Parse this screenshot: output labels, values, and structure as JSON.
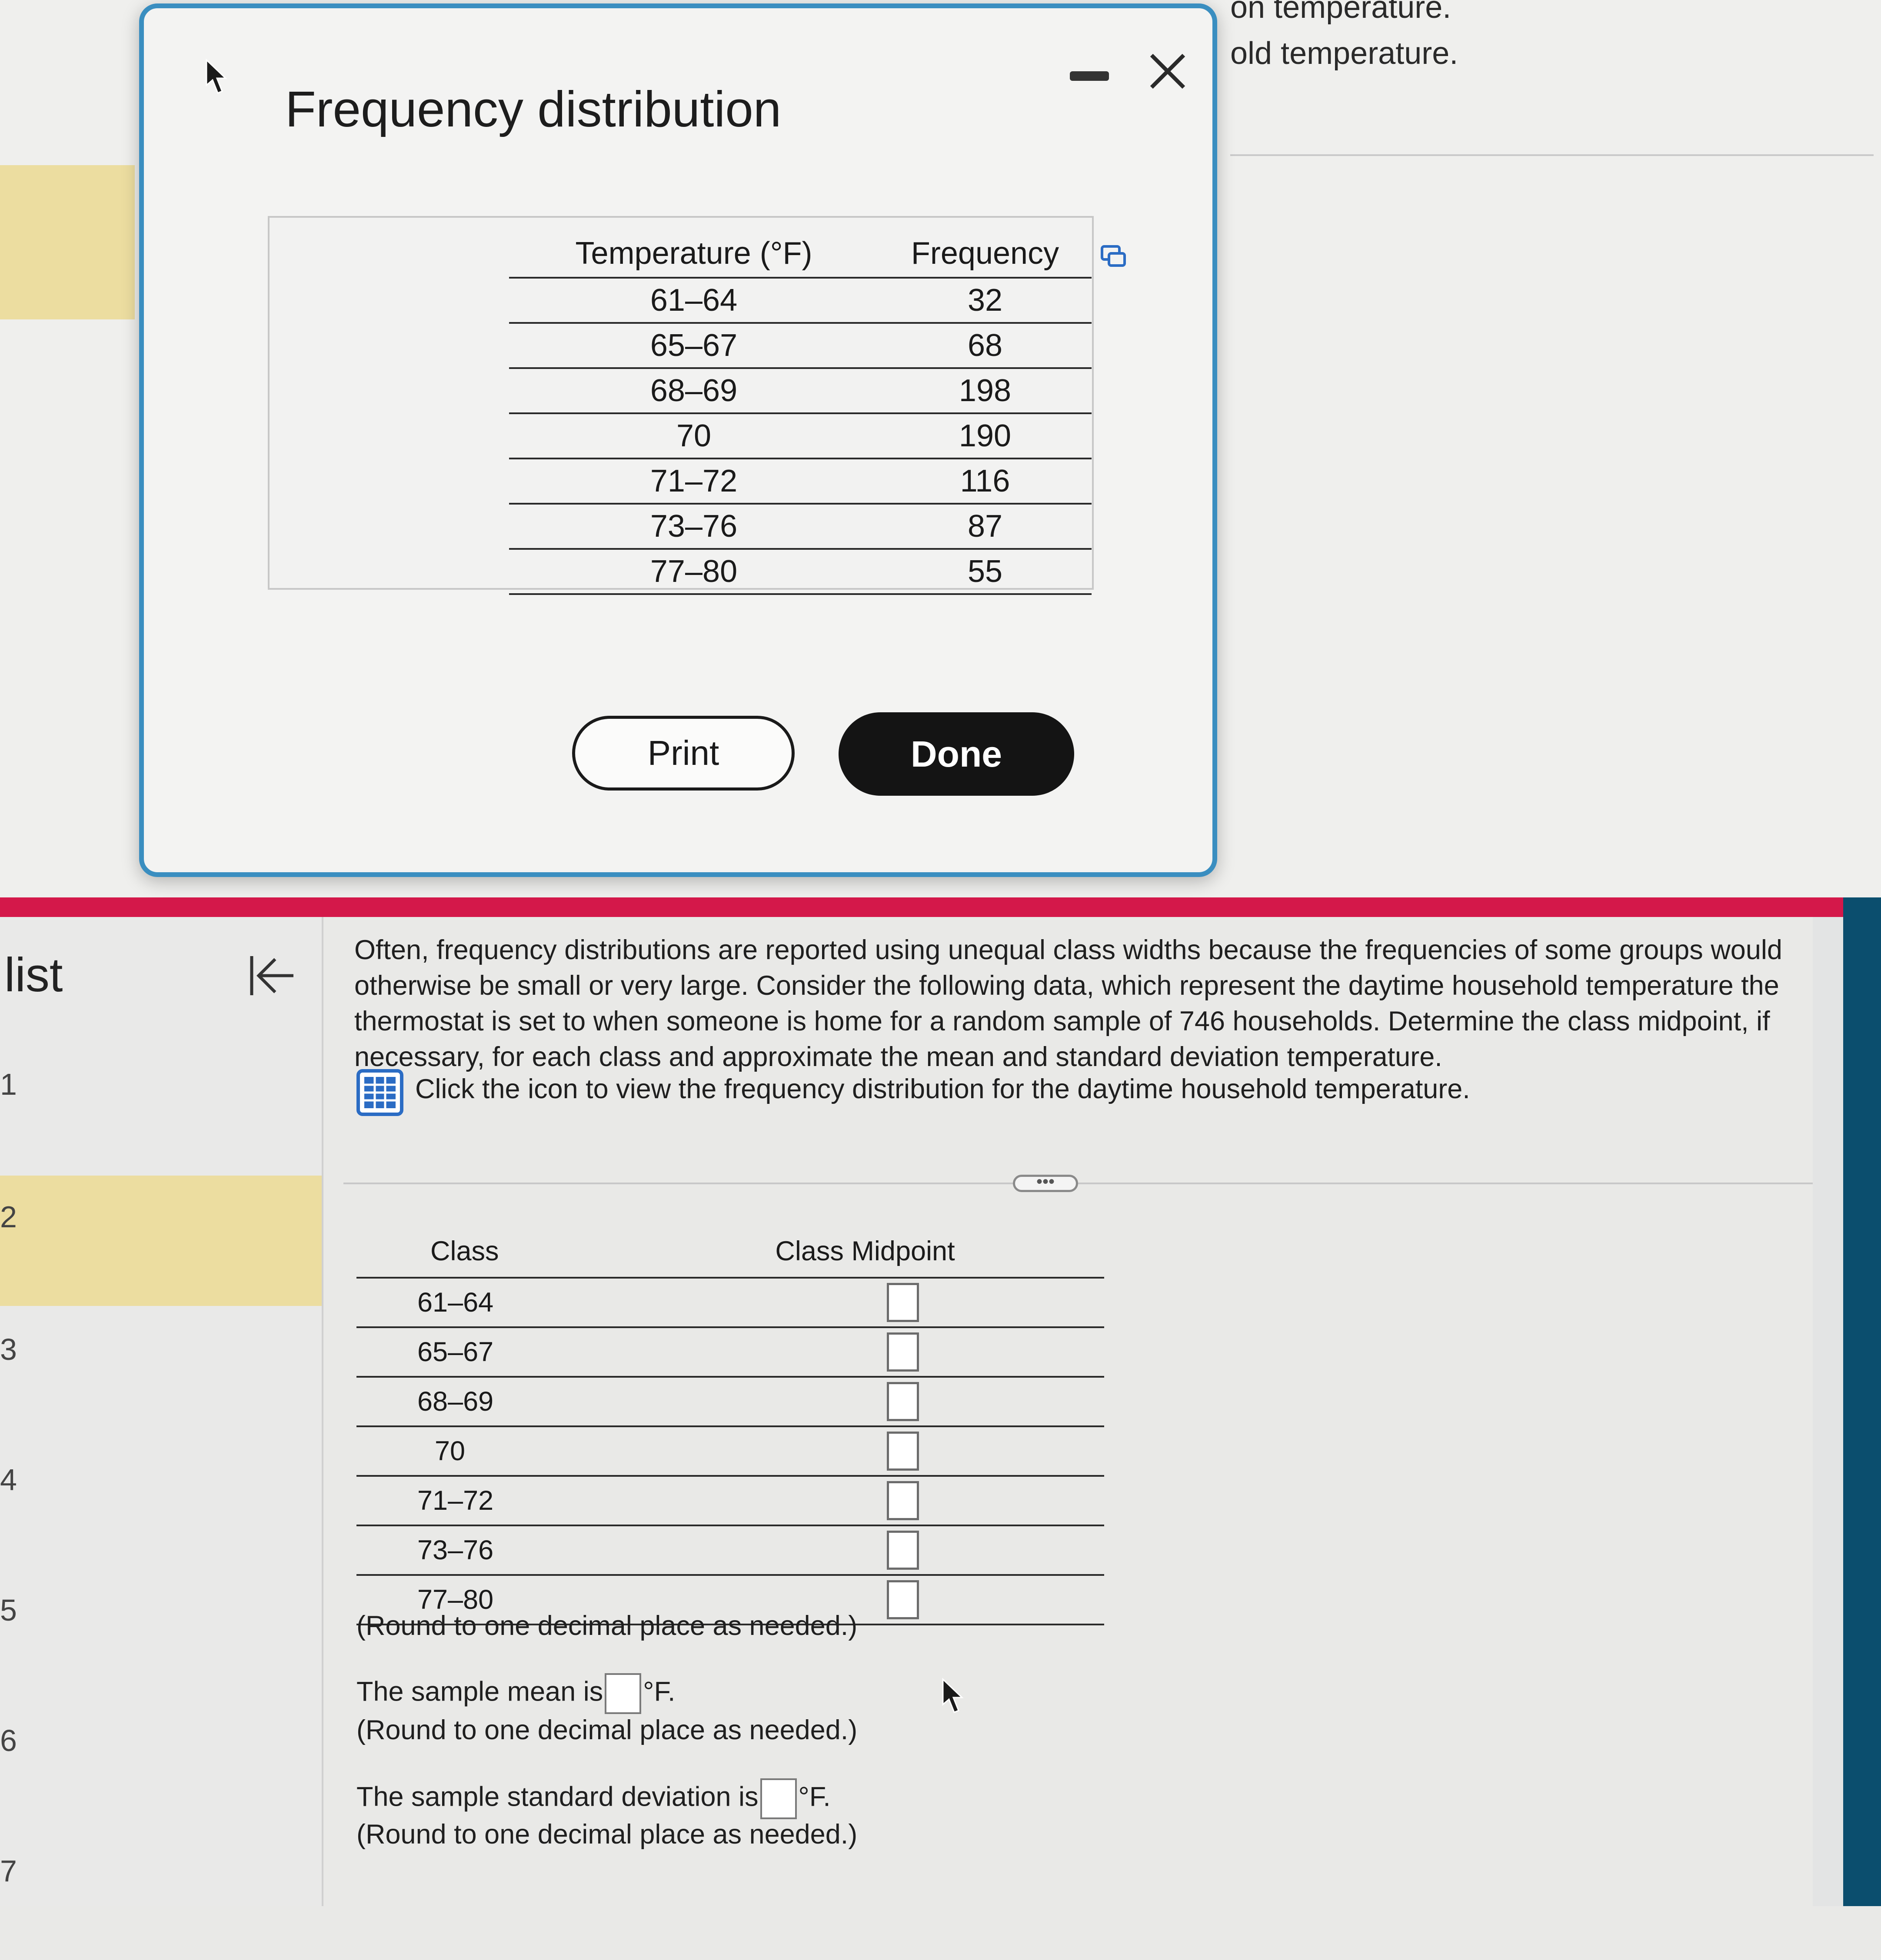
{
  "background": {
    "snippet_1": "on temperature.",
    "snippet_2": "old temperature."
  },
  "modal": {
    "title": "Frequency distribution",
    "table": {
      "headers": [
        "Temperature (°F)",
        "Frequency"
      ],
      "rows": [
        [
          "61–64",
          "32"
        ],
        [
          "65–67",
          "68"
        ],
        [
          "68–69",
          "198"
        ],
        [
          "70",
          "190"
        ],
        [
          "71–72",
          "116"
        ],
        [
          "73–76",
          "87"
        ],
        [
          "77–80",
          "55"
        ]
      ]
    },
    "print_label": "Print",
    "done_label": "Done"
  },
  "sidebar": {
    "label": "list",
    "items": [
      "1",
      "2",
      "3",
      "4",
      "5",
      "6",
      "7"
    ],
    "active_item": "2"
  },
  "question": {
    "text": "Often, frequency distributions are reported using unequal class widths because the frequencies of some groups would otherwise be small or very large. Consider the following data, which represent the daytime household temperature the thermostat is set to when someone is home for a random sample of 746 households. Determine the class midpoint, if necessary, for each class and approximate the mean and standard deviation temperature.",
    "icon_instruction": "Click the icon to view the frequency distribution for the daytime household temperature.",
    "more_label": "•••"
  },
  "midpoint_table": {
    "headers": [
      "Class",
      "Class Midpoint"
    ],
    "classes": [
      "61–64",
      "65–67",
      "68–69",
      "70",
      "71–72",
      "73–76",
      "77–80"
    ]
  },
  "round_note": "(Round to one decimal place as needed.)",
  "mean": {
    "prefix": "The sample mean is",
    "suffix": "°F."
  },
  "sd": {
    "prefix": "The sample standard deviation is",
    "suffix": "°F."
  },
  "colors": {
    "modal_border": "#3a8ec0",
    "red_bar": "#d4184a",
    "highlight": "#ecdda0",
    "done_button": "#141414",
    "icon_blue": "#2b6cc4",
    "right_panel": "#0b4e6e"
  }
}
